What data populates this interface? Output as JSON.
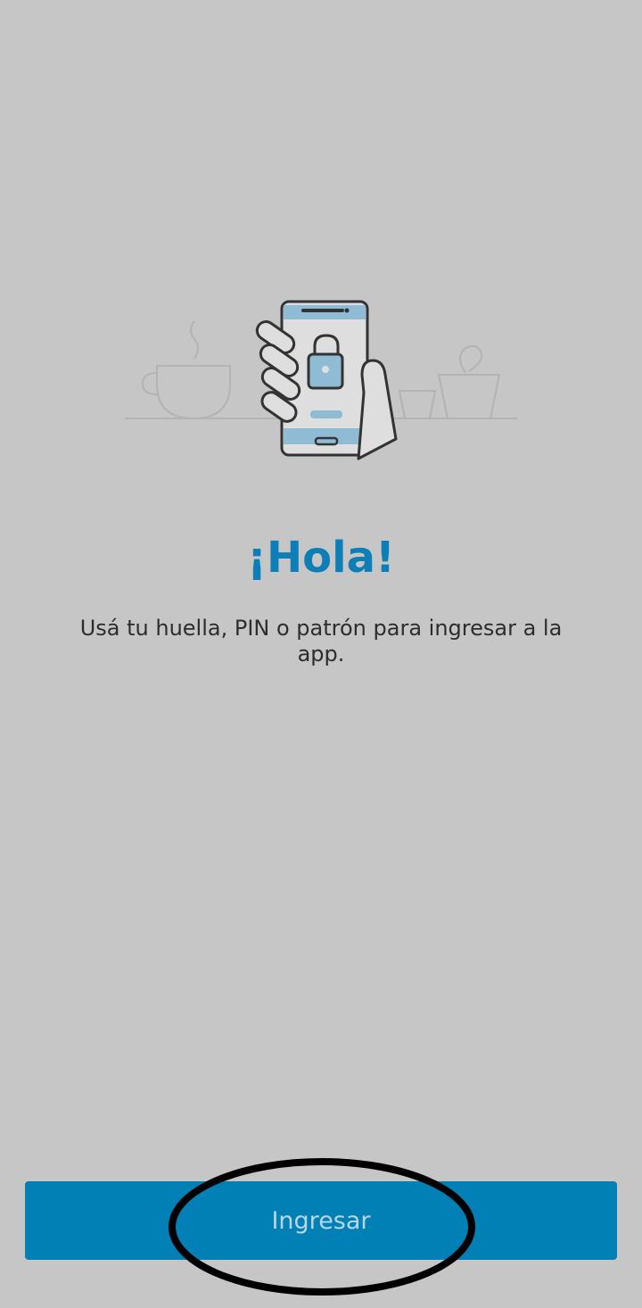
{
  "illustration": {
    "icon": "phone-lock-illustration",
    "accent_color": "#8fbcd4",
    "stroke_color": "#333333"
  },
  "greeting": {
    "title": "¡Hola!",
    "subtitle": "Usá tu huella, PIN o patrón para ingresar a la app.",
    "title_color": "#0e7fb6"
  },
  "actions": {
    "login_label": "Ingresar",
    "button_color": "#0080b5"
  },
  "annotation": {
    "type": "highlight-ellipse",
    "color": "#000000"
  }
}
